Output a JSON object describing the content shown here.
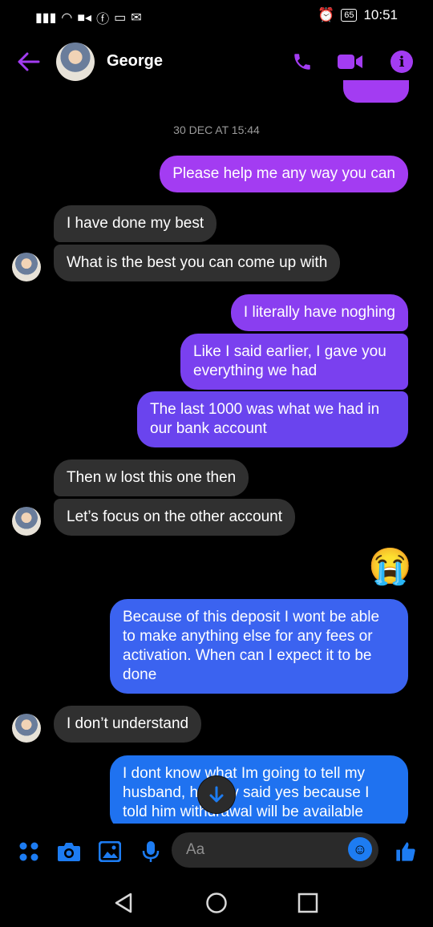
{
  "status_bar": {
    "left_icons": [
      "signal-icon",
      "wifi-icon",
      "video-call-icon",
      "facebook-icon",
      "laptop-icon",
      "mail-icon"
    ],
    "battery": "65",
    "time": "10:51"
  },
  "header": {
    "contact_name": "George"
  },
  "timestamp": "30 DEC AT 15:44",
  "messages": [
    {
      "side": "out",
      "text": "Please help me any way you can"
    },
    {
      "side": "in",
      "text": "I have done my best"
    },
    {
      "side": "in",
      "text": "What is the best you can come up with"
    },
    {
      "side": "out",
      "text": "I literally have noghing"
    },
    {
      "side": "out",
      "text": "Like I said earlier, I gave you everything we had"
    },
    {
      "side": "out",
      "text": "The last 1000 was what we had in our bank account"
    },
    {
      "side": "in",
      "text": "Then w lost this one then"
    },
    {
      "side": "in",
      "text": "Let’s focus on the other account"
    },
    {
      "side": "out",
      "text": "😭"
    },
    {
      "side": "out",
      "text": "Because of this deposit I wont be able to make anything else for any fees or activation. When can I expect it to be done"
    },
    {
      "side": "in",
      "text": "I don’t understand"
    },
    {
      "side": "out",
      "text": "I dont know what Im going to tell my husband, he only said yes because I told him withdrawal will be available"
    }
  ],
  "composer": {
    "placeholder": "Aa"
  },
  "colors": {
    "accent_purple": "#a33cf2",
    "accent_blue": "#1d7cf2",
    "incoming_bubble": "#303030"
  }
}
